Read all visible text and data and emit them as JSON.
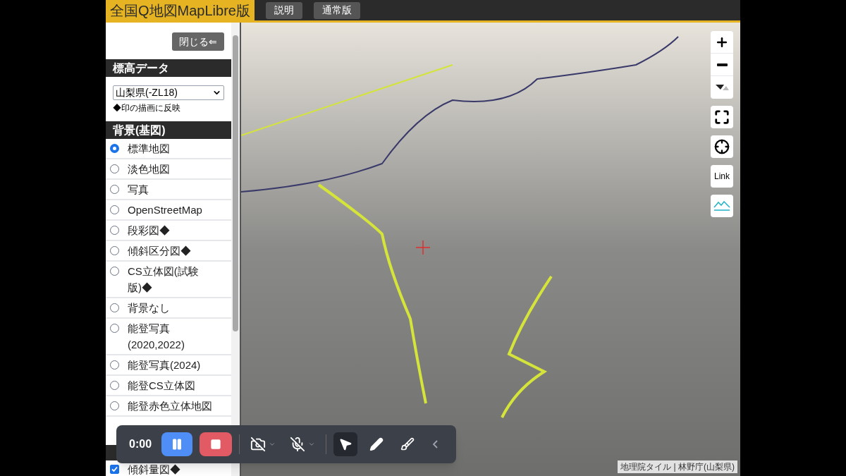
{
  "header": {
    "title": "全国Q地図MapLibre版",
    "buttons": [
      "説明",
      "通常版"
    ]
  },
  "sidebar": {
    "close_button": "閉じる⇐",
    "elevation": {
      "heading": "標高データ",
      "select_value": "山梨県(-ZL18)",
      "note": "◆印の描画に反映"
    },
    "background": {
      "heading": "背景(基図)",
      "items": [
        {
          "label": "標準地図",
          "selected": true
        },
        {
          "label": "淡色地図",
          "selected": false
        },
        {
          "label": "写真",
          "selected": false
        },
        {
          "label": "OpenStreetMap",
          "selected": false
        },
        {
          "label": "段彩図◆",
          "selected": false
        },
        {
          "label": "傾斜区分図◆",
          "selected": false
        },
        {
          "label": "CS立体図(試験版)◆",
          "selected": false
        },
        {
          "label": "背景なし",
          "selected": false
        },
        {
          "label": "能登写真(2020,2022)",
          "selected": false
        },
        {
          "label": "能登写真(2024)",
          "selected": false
        },
        {
          "label": "能登CS立体図",
          "selected": false
        },
        {
          "label": "能登赤色立体地図",
          "selected": false
        }
      ]
    },
    "overlays": [
      {
        "label": "傾斜量図◆",
        "checked": true
      }
    ]
  },
  "map_controls": [
    {
      "kind": "zoom-in"
    },
    {
      "kind": "zoom-out"
    },
    {
      "kind": "compass"
    },
    {
      "kind": "fullscreen"
    },
    {
      "kind": "locate"
    },
    {
      "kind": "link",
      "label": "Link"
    },
    {
      "kind": "terrain"
    }
  ],
  "attribution": "地理院タイル | 林野庁(山梨県)",
  "recorder": {
    "time": "0:00",
    "tools": [
      {
        "kind": "camera",
        "selected": false
      },
      {
        "kind": "mic",
        "selected": false
      },
      {
        "kind": "pointer",
        "selected": true
      },
      {
        "kind": "pen",
        "selected": false
      },
      {
        "kind": "eraser",
        "selected": false
      },
      {
        "kind": "collapse",
        "selected": false
      }
    ]
  }
}
